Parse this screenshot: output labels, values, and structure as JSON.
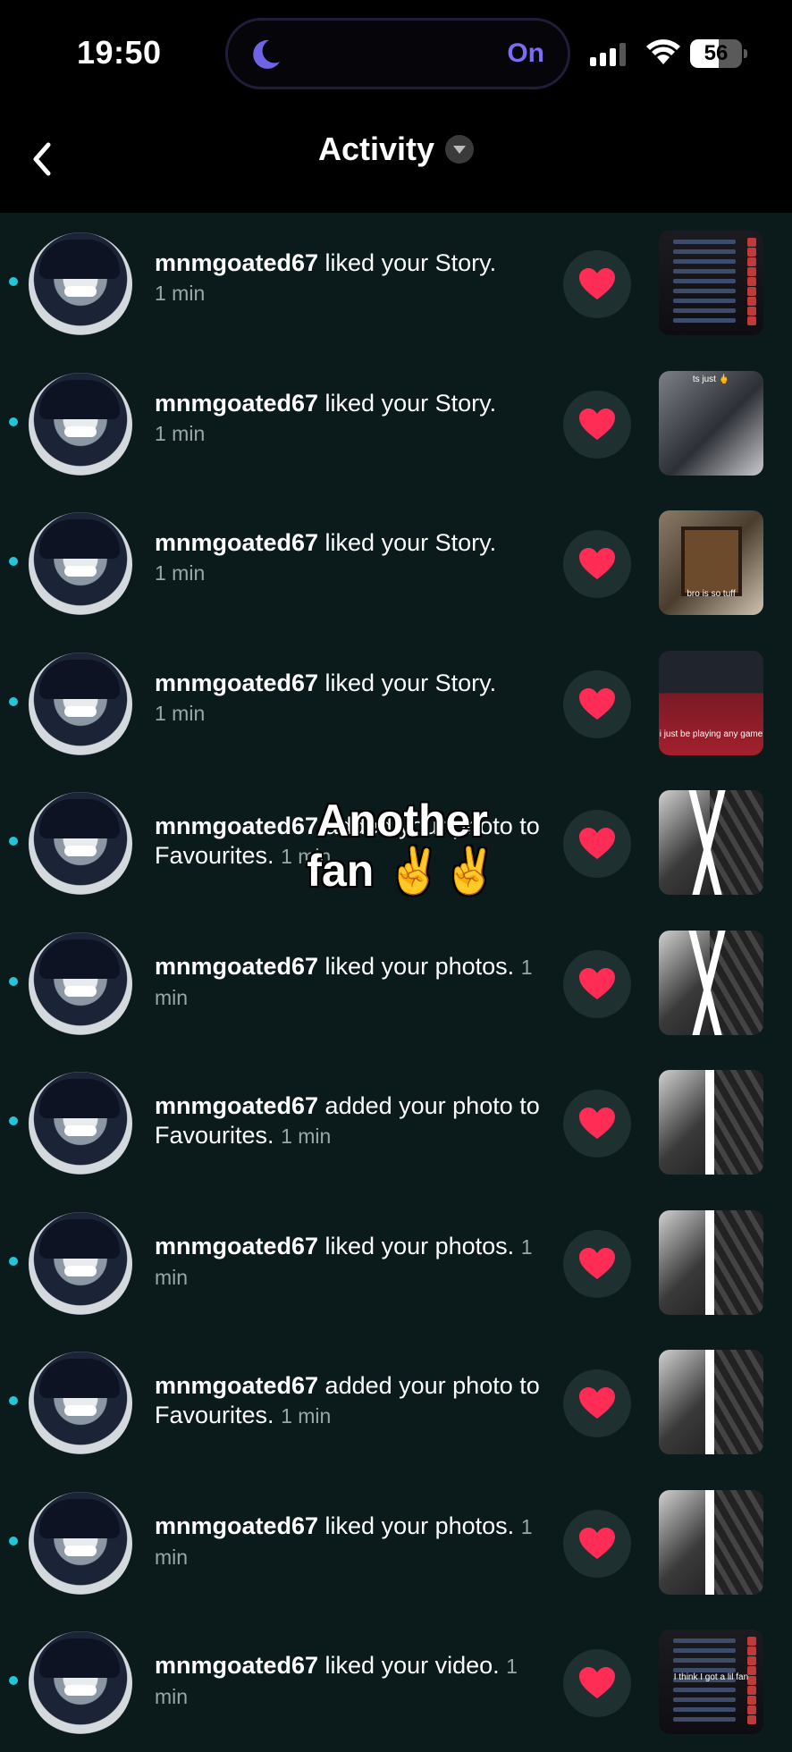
{
  "status_bar": {
    "time": "19:50",
    "focus_mode_label": "On",
    "battery_percent": "56",
    "battery_level": 0.56
  },
  "header": {
    "title": "Activity"
  },
  "items": [
    {
      "user": "mnmgoated67",
      "action": " liked your Story.",
      "time": "1 min",
      "time_inline": false,
      "thumb": "dark"
    },
    {
      "user": "mnmgoated67",
      "action": " liked your Story.",
      "time": "1 min",
      "time_inline": false,
      "thumb": "anime",
      "thumb_caption": "ts just 🖕"
    },
    {
      "user": "mnmgoated67",
      "action": " liked your Story.",
      "time": "1 min",
      "time_inline": false,
      "thumb": "frame",
      "thumb_caption": "bro is so tuff"
    },
    {
      "user": "mnmgoated67",
      "action": " liked your Story.",
      "time": "1 min",
      "time_inline": false,
      "thumb": "game",
      "thumb_caption": "i just be playing any game"
    },
    {
      "user": "mnmgoated67",
      "action": " added your photo to Favourites.",
      "time": "1 min",
      "time_inline": true,
      "thumb": "bw-x"
    },
    {
      "user": "mnmgoated67",
      "action": " liked your photos.",
      "time": "1 min",
      "time_inline": true,
      "thumb": "bw-x"
    },
    {
      "user": "mnmgoated67",
      "action": " added your photo to Favourites.",
      "time": "1 min",
      "time_inline": true,
      "thumb": "bw-i"
    },
    {
      "user": "mnmgoated67",
      "action": " liked your photos.",
      "time": "1 min",
      "time_inline": true,
      "thumb": "bw-i"
    },
    {
      "user": "mnmgoated67",
      "action": " added your photo to Favourites.",
      "time": "1 min",
      "time_inline": true,
      "thumb": "bw-i"
    },
    {
      "user": "mnmgoated67",
      "action": " liked your photos.",
      "time": "1 min",
      "time_inline": true,
      "thumb": "bw-i"
    },
    {
      "user": "mnmgoated67",
      "action": " liked your video.",
      "time": "1 min",
      "time_inline": true,
      "thumb": "dark",
      "thumb_caption": "I think I got a lil fan"
    }
  ],
  "overlay_caption": "Another fan ✌️✌️",
  "colors": {
    "background": "#0b1a1b",
    "unread_dot": "#23c6d9",
    "heart": "#ff2d55",
    "focus_accent": "#7b6cf0"
  }
}
